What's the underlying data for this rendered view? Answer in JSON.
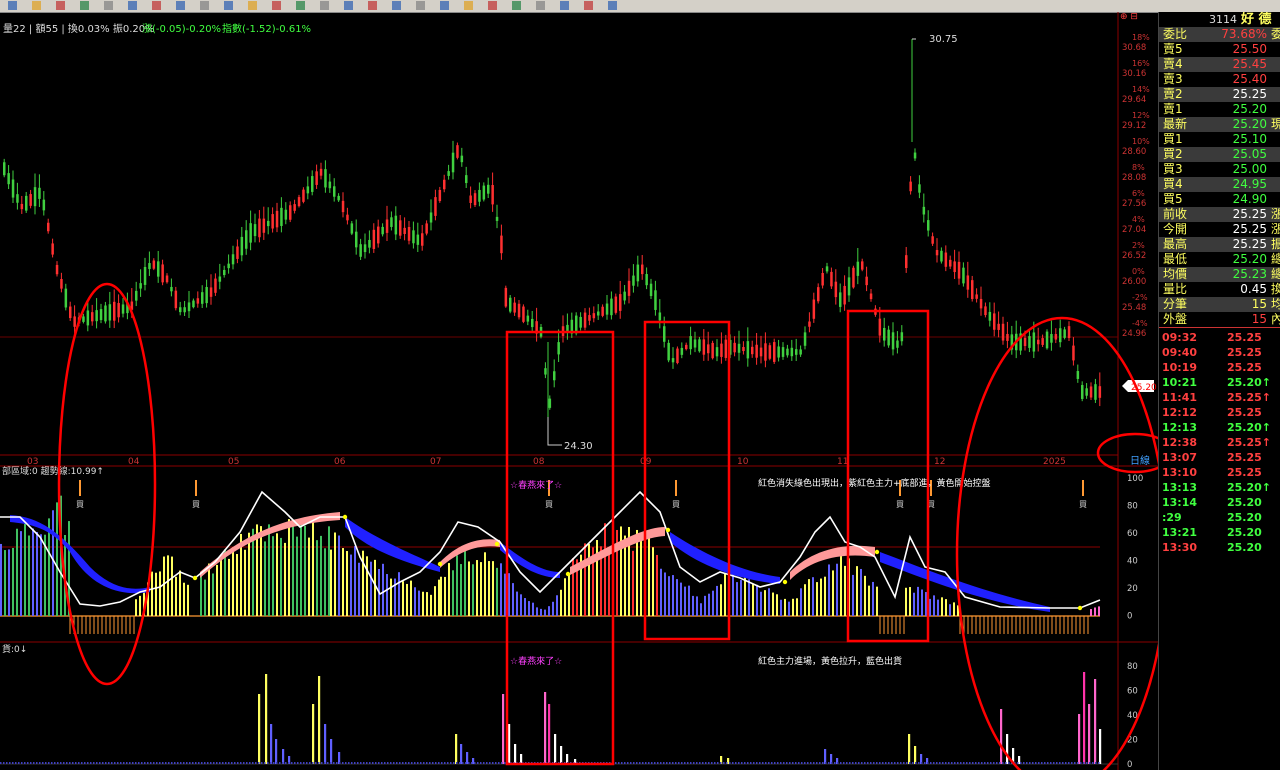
{
  "header": {
    "info_text": "量22 | 額55 | 換0.03% 振0.20%",
    "rise_text": "漲(-0.05)-0.20%",
    "index_text": "指數(-1.52)-0.61%"
  },
  "stock": {
    "code": "3114",
    "name": "好 德"
  },
  "price_axis": {
    "labels": [
      {
        "price": "30.68",
        "pct": "18%"
      },
      {
        "price": "30.16",
        "pct": "16%"
      },
      {
        "price": "29.64",
        "pct": "14%"
      },
      {
        "price": "29.12",
        "pct": "12%"
      },
      {
        "price": "28.60",
        "pct": "10%"
      },
      {
        "price": "28.08",
        "pct": "8%"
      },
      {
        "price": "27.56",
        "pct": "6%"
      },
      {
        "price": "27.04",
        "pct": "4%"
      },
      {
        "price": "26.52",
        "pct": "2%"
      },
      {
        "price": "26.00",
        "pct": "0%"
      },
      {
        "price": "25.48",
        "pct": "-2%"
      },
      {
        "price": "24.96",
        "pct": "-4%"
      }
    ],
    "current_tag": "25.20"
  },
  "annotations": {
    "high": "30.75",
    "low": "24.30"
  },
  "months": [
    "03",
    "04",
    "05",
    "06",
    "07",
    "08",
    "09",
    "10",
    "11",
    "12",
    "2025"
  ],
  "period_label": "日線",
  "indicator1": {
    "header": "部區域:0  趨勢線:10.99↑",
    "note_purple": "☆春燕來了☆",
    "note_white": "紅色消失綠色出現出，紫紅色主力+底部進，黃色開始控盤",
    "buy_label": "買",
    "axis": [
      "100",
      "80",
      "60",
      "40",
      "20",
      "0"
    ]
  },
  "indicator2": {
    "header": "貨:0↓",
    "note_purple": "☆春燕來了☆",
    "note_white": "紅色主力進場，黃色拉升，藍色出貨",
    "axis": [
      "80",
      "60",
      "40",
      "20",
      "0"
    ]
  },
  "quote": {
    "rows": [
      {
        "label": "委比",
        "value": "73.68%",
        "ext": "委差",
        "vc": "#ff4040",
        "bg": "#3a3a3a"
      },
      {
        "label": "賣5",
        "value": "25.50",
        "ext": "",
        "vc": "#ff4040",
        "bg": ""
      },
      {
        "label": "賣4",
        "value": "25.45",
        "ext": "",
        "vc": "#ff4040",
        "bg": "#3a3a3a"
      },
      {
        "label": "賣3",
        "value": "25.40",
        "ext": "",
        "vc": "#ff4040",
        "bg": ""
      },
      {
        "label": "賣2",
        "value": "25.25",
        "ext": "",
        "vc": "#ffffff",
        "bg": "#3a3a3a"
      },
      {
        "label": "賣1",
        "value": "25.20",
        "ext": "",
        "vc": "#40ff40",
        "bg": ""
      },
      {
        "label": "最新",
        "value": "25.20",
        "ext": "現張",
        "vc": "#40ff40",
        "bg": "#3a3a3a"
      },
      {
        "label": "買1",
        "value": "25.10",
        "ext": "",
        "vc": "#40ff40",
        "bg": ""
      },
      {
        "label": "買2",
        "value": "25.05",
        "ext": "",
        "vc": "#40ff40",
        "bg": "#3a3a3a"
      },
      {
        "label": "買3",
        "value": "25.00",
        "ext": "",
        "vc": "#40ff40",
        "bg": ""
      },
      {
        "label": "買4",
        "value": "24.95",
        "ext": "",
        "vc": "#40ff40",
        "bg": "#3a3a3a"
      },
      {
        "label": "買5",
        "value": "24.90",
        "ext": "",
        "vc": "#40ff40",
        "bg": ""
      },
      {
        "label": "前收",
        "value": "25.25",
        "ext": "漲跌",
        "vc": "#ffffff",
        "bg": "#3a3a3a"
      },
      {
        "label": "今開",
        "value": "25.25",
        "ext": "漲幅",
        "vc": "#ffffff",
        "bg": ""
      },
      {
        "label": "最高",
        "value": "25.25",
        "ext": "振幅",
        "vc": "#ffffff",
        "bg": "#3a3a3a"
      },
      {
        "label": "最低",
        "value": "25.20",
        "ext": "總額",
        "vc": "#40ff40",
        "bg": ""
      },
      {
        "label": "均價",
        "value": "25.23",
        "ext": "總張",
        "vc": "#40ff40",
        "bg": "#3a3a3a"
      },
      {
        "label": "量比",
        "value": "0.45",
        "ext": "換手",
        "vc": "#ffffff",
        "bg": ""
      },
      {
        "label": "分筆",
        "value": "15",
        "ext": "均量",
        "vc": "#ffff60",
        "bg": "#3a3a3a"
      },
      {
        "label": "外盤",
        "value": "15",
        "ext": "內盤",
        "vc": "#ff4040",
        "bg": ""
      }
    ],
    "ticks": [
      {
        "time": "09:32",
        "price": "25.25",
        "tc": "#ff4040",
        "pc": "#ff4040"
      },
      {
        "time": "09:40",
        "price": "25.25",
        "tc": "#ff4040",
        "pc": "#ff4040"
      },
      {
        "time": "10:19",
        "price": "25.25",
        "tc": "#ff4040",
        "pc": "#ff4040"
      },
      {
        "time": "10:21",
        "price": "25.20↑",
        "tc": "#40ff40",
        "pc": "#40ff40"
      },
      {
        "time": "11:41",
        "price": "25.25↑",
        "tc": "#ff4040",
        "pc": "#ff4040"
      },
      {
        "time": "12:12",
        "price": "25.25",
        "tc": "#ff4040",
        "pc": "#ff4040"
      },
      {
        "time": "12:13",
        "price": "25.20↑",
        "tc": "#40ff40",
        "pc": "#40ff40"
      },
      {
        "time": "12:38",
        "price": "25.25↑",
        "tc": "#ff4040",
        "pc": "#ff4040"
      },
      {
        "time": "13:07",
        "price": "25.25",
        "tc": "#ff4040",
        "pc": "#ff4040"
      },
      {
        "time": "13:10",
        "price": "25.25",
        "tc": "#ff4040",
        "pc": "#ff4040"
      },
      {
        "time": "13:13",
        "price": "25.20↑",
        "tc": "#40ff40",
        "pc": "#40ff40"
      },
      {
        "time": "13:14",
        "price": "25.20",
        "tc": "#40ff40",
        "pc": "#40ff40"
      },
      {
        "time": ":29",
        "price": "25.20",
        "tc": "#40ff40",
        "pc": "#40ff40"
      },
      {
        "time": "13:21",
        "price": "25.20",
        "tc": "#40ff40",
        "pc": "#40ff40"
      },
      {
        "time": "13:30",
        "price": "25.20",
        "tc": "#ff4040",
        "pc": "#40ff40"
      }
    ]
  }
}
